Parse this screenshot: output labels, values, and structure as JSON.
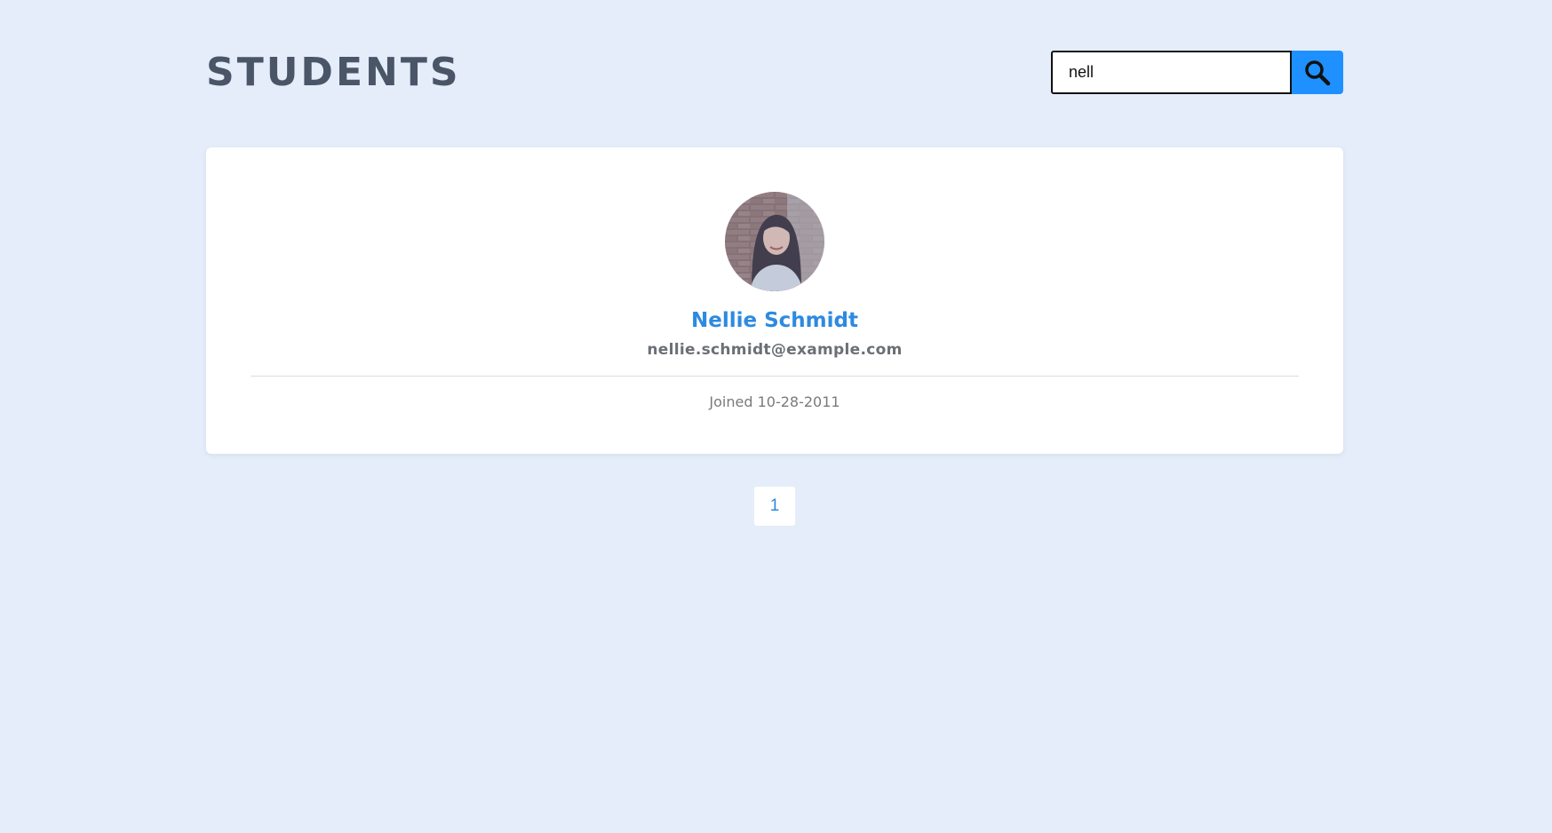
{
  "header": {
    "title": "STUDENTS"
  },
  "search": {
    "value": "nell",
    "button_icon": "search-icon"
  },
  "students": [
    {
      "name": "Nellie Schmidt",
      "email": "nellie.schmidt@example.com",
      "joined": "Joined 10-28-2011",
      "avatar_icon": "avatar-photo"
    }
  ],
  "pagination": {
    "pages": [
      "1"
    ],
    "current": "1"
  },
  "colors": {
    "background": "#e4edf9",
    "accent": "#1e90ff",
    "name": "#2d8ae0",
    "title": "#4a5568"
  }
}
